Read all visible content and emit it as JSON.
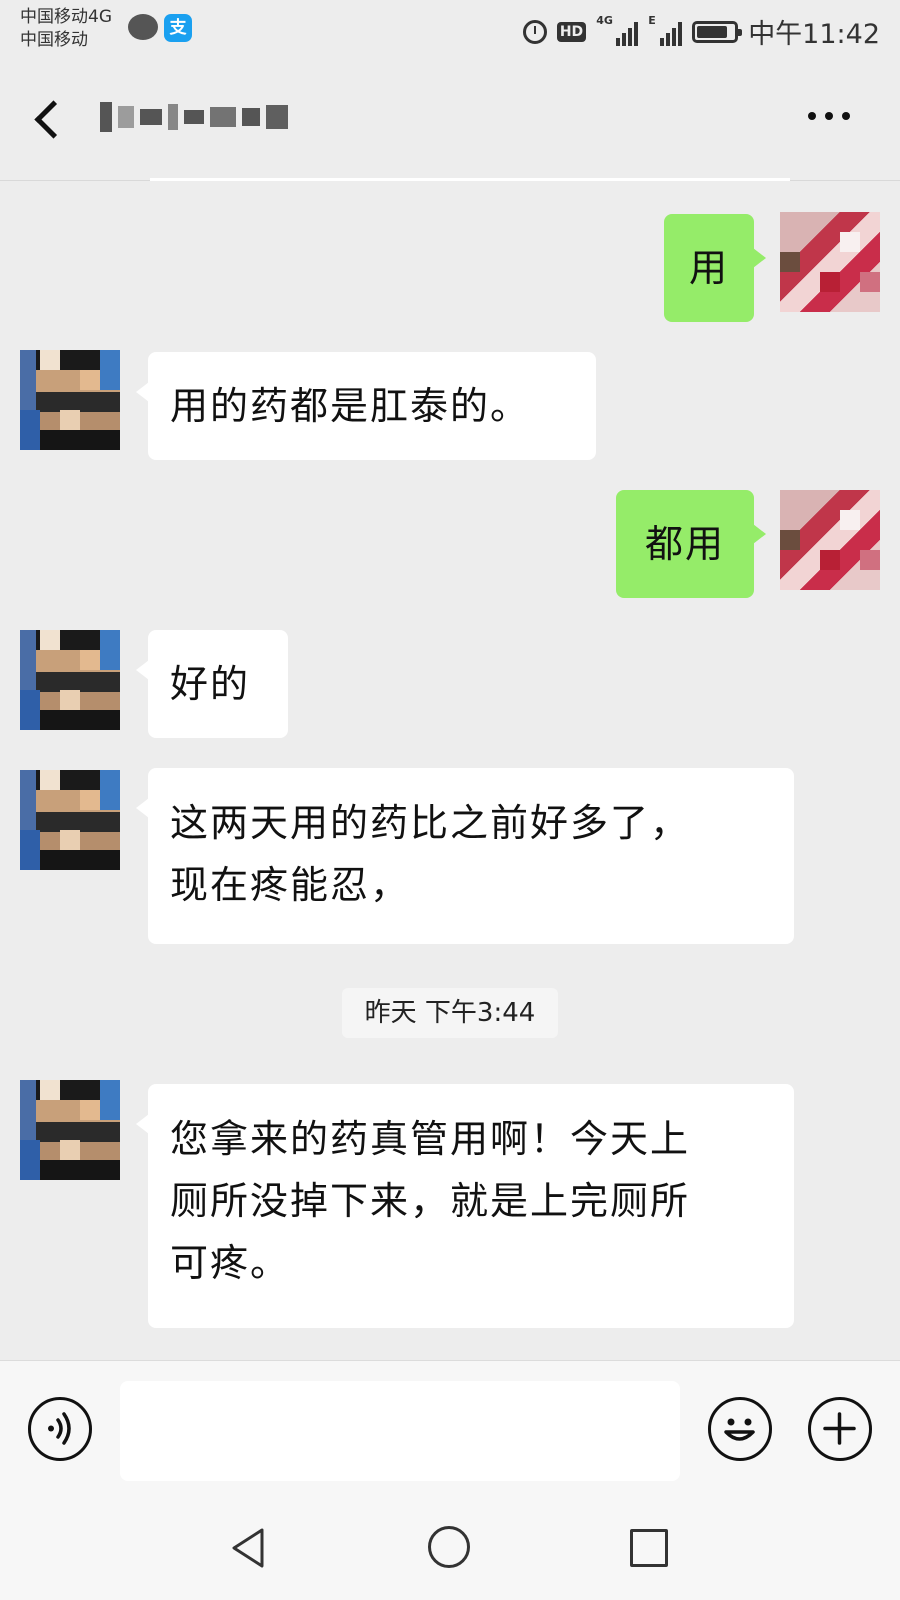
{
  "status_bar": {
    "carrier_line1": "中国移动4G",
    "carrier_line2": "中国移动",
    "network_label": "4G",
    "edge_label": "E",
    "hd_label": "HD",
    "time": "中午11:42",
    "icons": [
      "chat-bubble-icon",
      "alipay-icon",
      "alarm-icon",
      "hd-icon",
      "signal-icon",
      "battery-icon"
    ]
  },
  "header": {
    "back_icon": "chevron-left-icon",
    "contact_name": "",
    "more_icon": "more-dots-icon"
  },
  "messages": [
    {
      "side": "out",
      "text": "用"
    },
    {
      "side": "in",
      "text": "用的药都是肛泰的。"
    },
    {
      "side": "out",
      "text": "都用"
    },
    {
      "side": "in",
      "text": "好的"
    },
    {
      "side": "in",
      "text": "这两天用的药比之前好多了，\n现在疼能忍，"
    },
    {
      "side": "in",
      "text": "您拿来的药真管用啊！今天上\n厕所没掉下来，就是上完厕所\n可疼。"
    }
  ],
  "timestamp": "昨天 下午3:44",
  "input_bar": {
    "voice_icon": "voice-icon",
    "input_value": "",
    "emoji_icon": "emoji-icon",
    "plus_icon": "plus-icon"
  },
  "nav_bar": {
    "icons": [
      "nav-back-icon",
      "nav-home-icon",
      "nav-recent-icon"
    ]
  },
  "colors": {
    "background": "#ededed",
    "outgoing_bubble": "#95ec69",
    "incoming_bubble": "#ffffff"
  }
}
